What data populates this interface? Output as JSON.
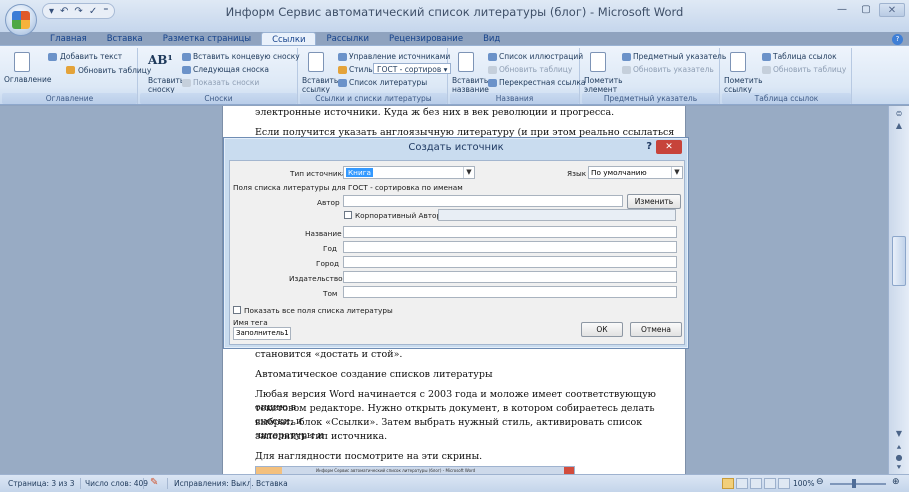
{
  "window": {
    "title": "Информ Сервис автоматический список литературы (блог) - Microsoft Word",
    "controls": [
      "minimize",
      "maximize",
      "close"
    ]
  },
  "ribbon_tabs": [
    "Главная",
    "Вставка",
    "Разметка страницы",
    "Ссылки",
    "Рассылки",
    "Рецензирование",
    "Вид"
  ],
  "active_tab": "Ссылки",
  "ribbon": {
    "toc": {
      "big": "Оглавление",
      "add_text": "Добавить текст",
      "update_table": "Обновить таблицу",
      "group": "Оглавление"
    },
    "footnotes": {
      "insert_footnote": "Вставить сноску",
      "insert_endnote": "Вставить концевую сноску",
      "next_footnote": "Следующая сноска",
      "show_notes": "Показать сноски",
      "group": "Сноски"
    },
    "citations": {
      "insert_citation": "Вставить ссылку",
      "manage_sources": "Управление источниками",
      "style_label": "Стиль:",
      "style_value": "ГОСТ - сортиров",
      "bibliography": "Список литературы",
      "group": "Ссылки и списки литературы"
    },
    "captions": {
      "insert_caption": "Вставить название",
      "table_of_figures": "Список иллюстраций",
      "update_table": "Обновить таблицу",
      "cross_reference": "Перекрестная ссылка",
      "group": "Названия"
    },
    "index": {
      "mark_entry": "Пометить элемент",
      "insert_index": "Предметный указатель",
      "update_index": "Обновить указатель",
      "group": "Предметный указатель"
    },
    "authorities": {
      "mark_citation": "Пометить ссылку",
      "insert_table": "Таблица ссылок",
      "update_table": "Обновить таблицу",
      "group": "Таблица ссылок"
    }
  },
  "document": {
    "line1": "электронные источники. Куда ж без них в век революции и прогресса.",
    "line2": "Если получится указать англоязычную литературу (и при этом реально ссылаться на нее в",
    "line3": "становится «достать и стой».",
    "heading": "Автоматическое создание списков литературы",
    "para": [
      "Любая версия Word начинается с 2003 года и моложе имеет соответствующую опцию в",
      "текстовом редакторе. Нужно открыть документ, в котором собираетесь делать сноски, и",
      "выбрать блок «Ссылки». Затем выбрать нужный стиль, активировать список литературы и",
      "заполнить тип источника."
    ],
    "closing": "Для наглядности посмотрите на эти скрины.",
    "thumb_title": "Информ Сервис автоматический список литературы (блог) - Microsoft Word"
  },
  "dialog": {
    "title": "Создать источник",
    "help": "?",
    "close": "✕",
    "source_type_label": "Тип источника",
    "source_type_value": "Книга",
    "language_label": "Язык",
    "language_value": "По умолчанию",
    "fields_caption": "Поля списка литературы для ГОСТ - сортировка по именам",
    "author_label": "Автор",
    "edit_button": "Изменить",
    "corporate_author_label": "Корпоративный Автор",
    "title_label": "Название",
    "year_label": "Год",
    "city_label": "Город",
    "publisher_label": "Издательство",
    "volume_label": "Том",
    "show_all_label": "Показать все поля списка литературы",
    "tag_label": "Имя тега",
    "tag_value": "Заполнитель1",
    "ok": "ОК",
    "cancel": "Отмена"
  },
  "status": {
    "page": "Страница: 3 из 3",
    "words": "Число слов: 409",
    "track": "Исправления: Выкл.",
    "mode": "Вставка",
    "zoom": "100%"
  }
}
